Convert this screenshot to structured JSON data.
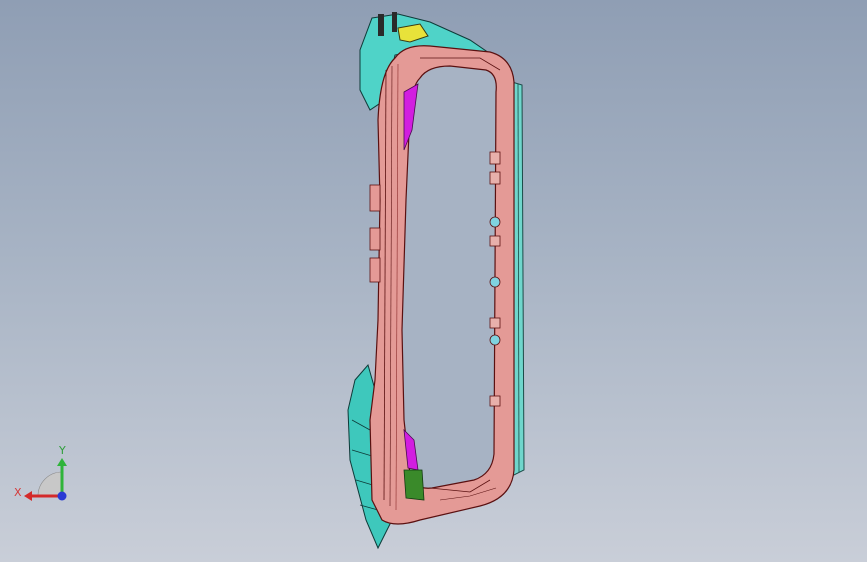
{
  "viewport": {
    "background_top": "#8f9eb4",
    "background_bottom": "#c9ced8"
  },
  "model": {
    "frame_fill": "#e49a96",
    "frame_stroke": "#5a1010",
    "flange_color": "#4fd3c8",
    "accent_magenta": "#d21ee0",
    "accent_yellow": "#e8e23a",
    "accent_green": "#3a8a2a"
  },
  "triad": {
    "x_label": "X",
    "y_label": "Y",
    "x_color": "#d42a2a",
    "y_color": "#2fb43a",
    "z_color": "#2a3ad4"
  }
}
